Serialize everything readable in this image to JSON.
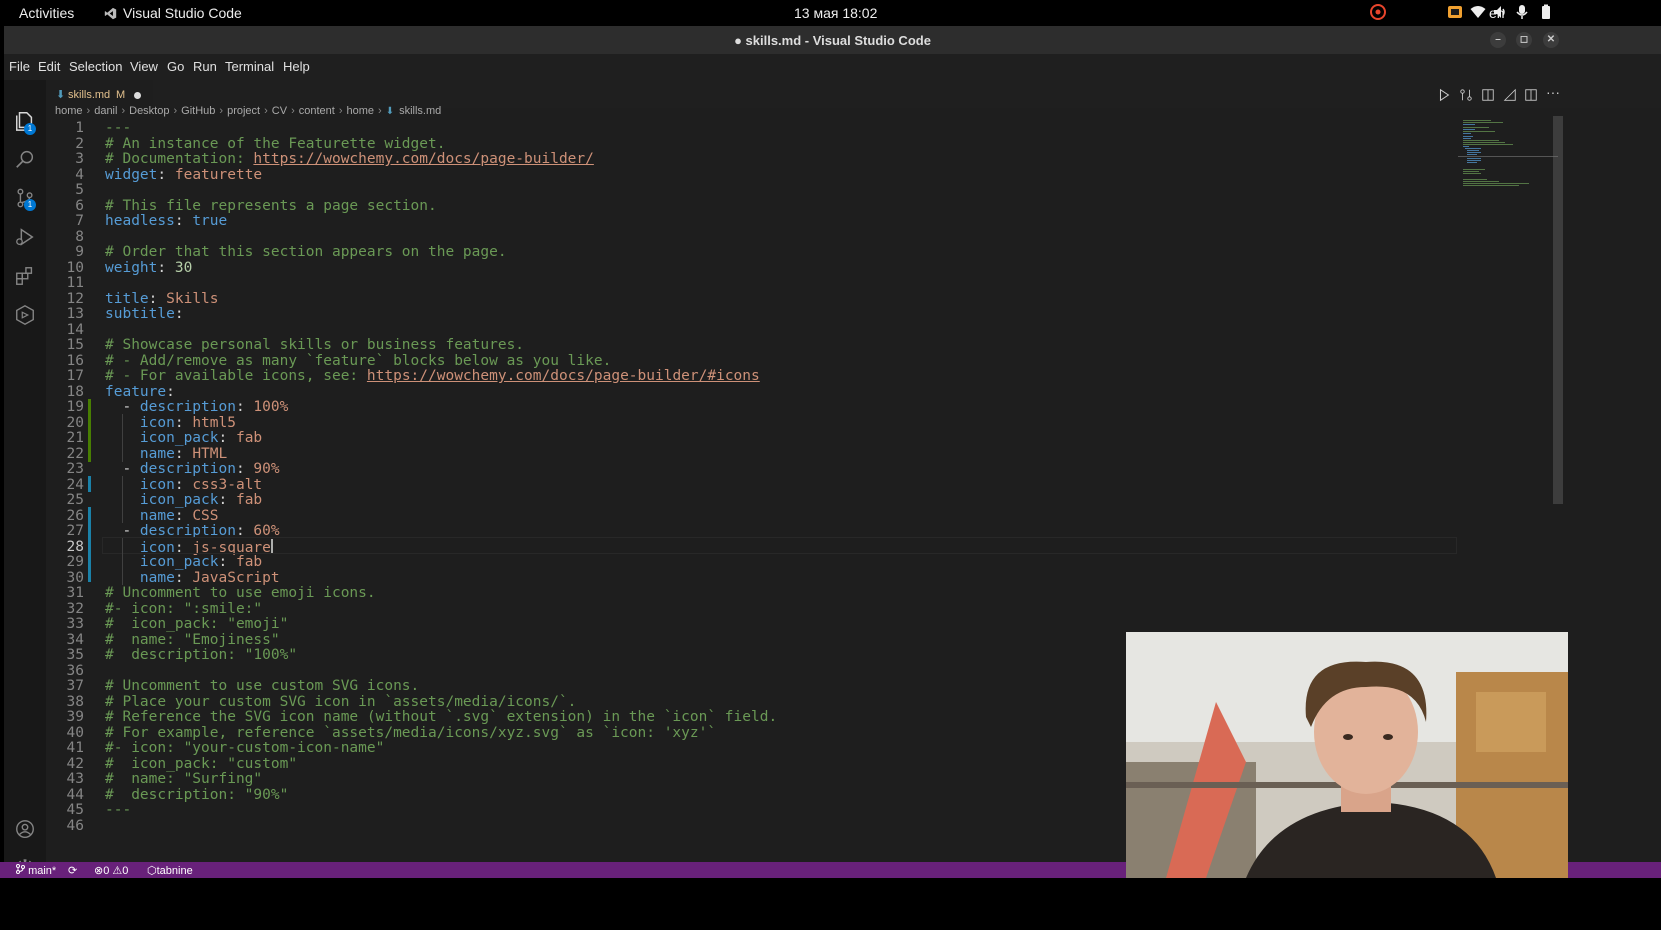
{
  "topbar": {
    "activities": "Activities",
    "app_name": "Visual Studio Code",
    "clock": "13 мая  18:02",
    "language": "en"
  },
  "window": {
    "title": "● skills.md - Visual Studio Code"
  },
  "menu": [
    "File",
    "Edit",
    "Selection",
    "View",
    "Go",
    "Run",
    "Terminal",
    "Help"
  ],
  "activity_bar": {
    "explorer_badge": "1",
    "source_control_badge": "1"
  },
  "tab": {
    "label": "skills.md",
    "modified_flag": "M"
  },
  "breadcrumbs": [
    "home",
    "danil",
    "Desktop",
    "GitHub",
    "project",
    "CV",
    "content",
    "home",
    "skills.md"
  ],
  "editor": {
    "active_line": 28,
    "lines": [
      [
        [
          "c-comment",
          "---"
        ]
      ],
      [
        [
          "c-comment",
          "# An instance of the Featurette widget."
        ]
      ],
      [
        [
          "c-comment",
          "# Documentation: "
        ],
        [
          "c-link",
          "https://wowchemy.com/docs/page-builder/"
        ]
      ],
      [
        [
          "c-key",
          "widget"
        ],
        [
          "c-dash",
          ": "
        ],
        [
          "c-str",
          "featurette"
        ]
      ],
      [],
      [
        [
          "c-comment",
          "# This file represents a page section."
        ]
      ],
      [
        [
          "c-key",
          "headless"
        ],
        [
          "c-dash",
          ": "
        ],
        [
          "c-key",
          "true"
        ]
      ],
      [],
      [
        [
          "c-comment",
          "# Order that this section appears on the page."
        ]
      ],
      [
        [
          "c-key",
          "weight"
        ],
        [
          "c-dash",
          ": "
        ],
        [
          "c-num",
          "30"
        ]
      ],
      [],
      [
        [
          "c-key",
          "title"
        ],
        [
          "c-dash",
          ": "
        ],
        [
          "c-str",
          "Skills"
        ]
      ],
      [
        [
          "c-key",
          "subtitle"
        ],
        [
          "c-dash",
          ":"
        ]
      ],
      [],
      [
        [
          "c-comment",
          "# Showcase personal skills or business features."
        ]
      ],
      [
        [
          "c-comment",
          "# - Add/remove as many `feature` blocks below as you like."
        ]
      ],
      [
        [
          "c-comment",
          "# - For available icons, see: "
        ],
        [
          "c-link",
          "https://wowchemy.com/docs/page-builder/#icons"
        ]
      ],
      [
        [
          "c-key",
          "feature"
        ],
        [
          "c-dash",
          ":"
        ]
      ],
      [
        [
          "c-dash",
          "  - "
        ],
        [
          "c-key",
          "description"
        ],
        [
          "c-dash",
          ": "
        ],
        [
          "c-str",
          "100%"
        ]
      ],
      [
        [
          "c-dash",
          "    "
        ],
        [
          "c-key",
          "icon"
        ],
        [
          "c-dash",
          ": "
        ],
        [
          "c-str",
          "html5"
        ]
      ],
      [
        [
          "c-dash",
          "    "
        ],
        [
          "c-key",
          "icon_pack"
        ],
        [
          "c-dash",
          ": "
        ],
        [
          "c-str",
          "fab"
        ]
      ],
      [
        [
          "c-dash",
          "    "
        ],
        [
          "c-key",
          "name"
        ],
        [
          "c-dash",
          ": "
        ],
        [
          "c-str",
          "HTML"
        ]
      ],
      [
        [
          "c-dash",
          "  - "
        ],
        [
          "c-key",
          "description"
        ],
        [
          "c-dash",
          ": "
        ],
        [
          "c-str",
          "90%"
        ]
      ],
      [
        [
          "c-dash",
          "    "
        ],
        [
          "c-key",
          "icon"
        ],
        [
          "c-dash",
          ": "
        ],
        [
          "c-str",
          "css3-alt"
        ]
      ],
      [
        [
          "c-dash",
          "    "
        ],
        [
          "c-key",
          "icon_pack"
        ],
        [
          "c-dash",
          ": "
        ],
        [
          "c-str",
          "fab"
        ]
      ],
      [
        [
          "c-dash",
          "    "
        ],
        [
          "c-key",
          "name"
        ],
        [
          "c-dash",
          ": "
        ],
        [
          "c-str",
          "CSS"
        ]
      ],
      [
        [
          "c-dash",
          "  - "
        ],
        [
          "c-key",
          "description"
        ],
        [
          "c-dash",
          ": "
        ],
        [
          "c-str",
          "60%"
        ]
      ],
      [
        [
          "c-dash",
          "    "
        ],
        [
          "c-key",
          "icon"
        ],
        [
          "c-dash",
          ": "
        ],
        [
          "c-str",
          "js-square"
        ]
      ],
      [
        [
          "c-dash",
          "    "
        ],
        [
          "c-key",
          "icon_pack"
        ],
        [
          "c-dash",
          ": "
        ],
        [
          "c-str",
          "fab"
        ]
      ],
      [
        [
          "c-dash",
          "    "
        ],
        [
          "c-key",
          "name"
        ],
        [
          "c-dash",
          ": "
        ],
        [
          "c-str",
          "JavaScript"
        ]
      ],
      [
        [
          "c-comment",
          "# Uncomment to use emoji icons."
        ]
      ],
      [
        [
          "c-comment",
          "#- icon: \":smile:\""
        ]
      ],
      [
        [
          "c-comment",
          "#  icon_pack: \"emoji\""
        ]
      ],
      [
        [
          "c-comment",
          "#  name: \"Emojiness\""
        ]
      ],
      [
        [
          "c-comment",
          "#  description: \"100%\""
        ]
      ],
      [],
      [
        [
          "c-comment",
          "# Uncomment to use custom SVG icons."
        ]
      ],
      [
        [
          "c-comment",
          "# Place your custom SVG icon in `assets/media/icons/`."
        ]
      ],
      [
        [
          "c-comment",
          "# Reference the SVG icon name (without `.svg` extension) in the `icon` field."
        ]
      ],
      [
        [
          "c-comment",
          "# For example, reference `assets/media/icons/xyz.svg` as `icon: 'xyz'`"
        ]
      ],
      [
        [
          "c-comment",
          "#- icon: \"your-custom-icon-name\""
        ]
      ],
      [
        [
          "c-comment",
          "#  icon_pack: \"custom\""
        ]
      ],
      [
        [
          "c-comment",
          "#  name: \"Surfing\""
        ]
      ],
      [
        [
          "c-comment",
          "#  description: \"90%\""
        ]
      ],
      [
        [
          "c-comment",
          "---"
        ]
      ],
      []
    ]
  },
  "statusbar": {
    "branch": "main*",
    "errors": "0",
    "warnings": "0",
    "extension": "tabnine"
  },
  "colors": {
    "statusbar": "#68217a",
    "editor_bg": "#1e1e1e",
    "comment": "#6a9955",
    "key": "#569cd6",
    "string": "#ce9178"
  }
}
